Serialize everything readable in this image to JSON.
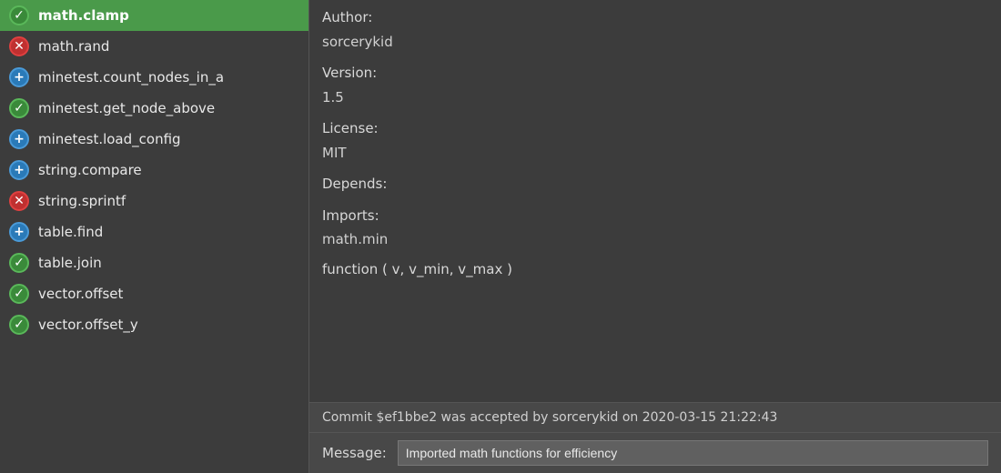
{
  "list": {
    "items": [
      {
        "id": "math-clamp",
        "label": "math.clamp",
        "icon": "check",
        "active": true
      },
      {
        "id": "math-rand",
        "label": "math.rand",
        "icon": "x",
        "active": false
      },
      {
        "id": "minetest-count",
        "label": "minetest.count_nodes_in_a",
        "icon": "plus",
        "active": false
      },
      {
        "id": "minetest-get",
        "label": "minetest.get_node_above",
        "icon": "check",
        "active": false
      },
      {
        "id": "minetest-load",
        "label": "minetest.load_config",
        "icon": "plus",
        "active": false
      },
      {
        "id": "string-compare",
        "label": "string.compare",
        "icon": "plus",
        "active": false
      },
      {
        "id": "string-sprintf",
        "label": "string.sprintf",
        "icon": "x",
        "active": false
      },
      {
        "id": "table-find",
        "label": "table.find",
        "icon": "plus",
        "active": false
      },
      {
        "id": "table-join",
        "label": "table.join",
        "icon": "check",
        "active": false
      },
      {
        "id": "vector-offset",
        "label": "vector.offset",
        "icon": "check",
        "active": false
      },
      {
        "id": "vector-offset-y",
        "label": "vector.offset_y",
        "icon": "check",
        "active": false
      }
    ]
  },
  "info": {
    "author_label": "Author:",
    "author_value": "sorcerykid",
    "version_label": "Version:",
    "version_value": "1.5",
    "license_label": "License:",
    "license_value": "MIT",
    "depends_label": "Depends:",
    "depends_value": "",
    "imports_label": "Imports:",
    "imports_value": "math.min",
    "function_sig": "function ( v, v_min, v_max )"
  },
  "commit": {
    "text": "Commit $ef1bbe2 was accepted by sorcerykid on 2020-03-15 21:22:43"
  },
  "message": {
    "label": "Message:",
    "value": "Imported math functions for efficiency",
    "placeholder": ""
  },
  "icons": {
    "check": "✓",
    "x": "✕",
    "plus": "+"
  }
}
